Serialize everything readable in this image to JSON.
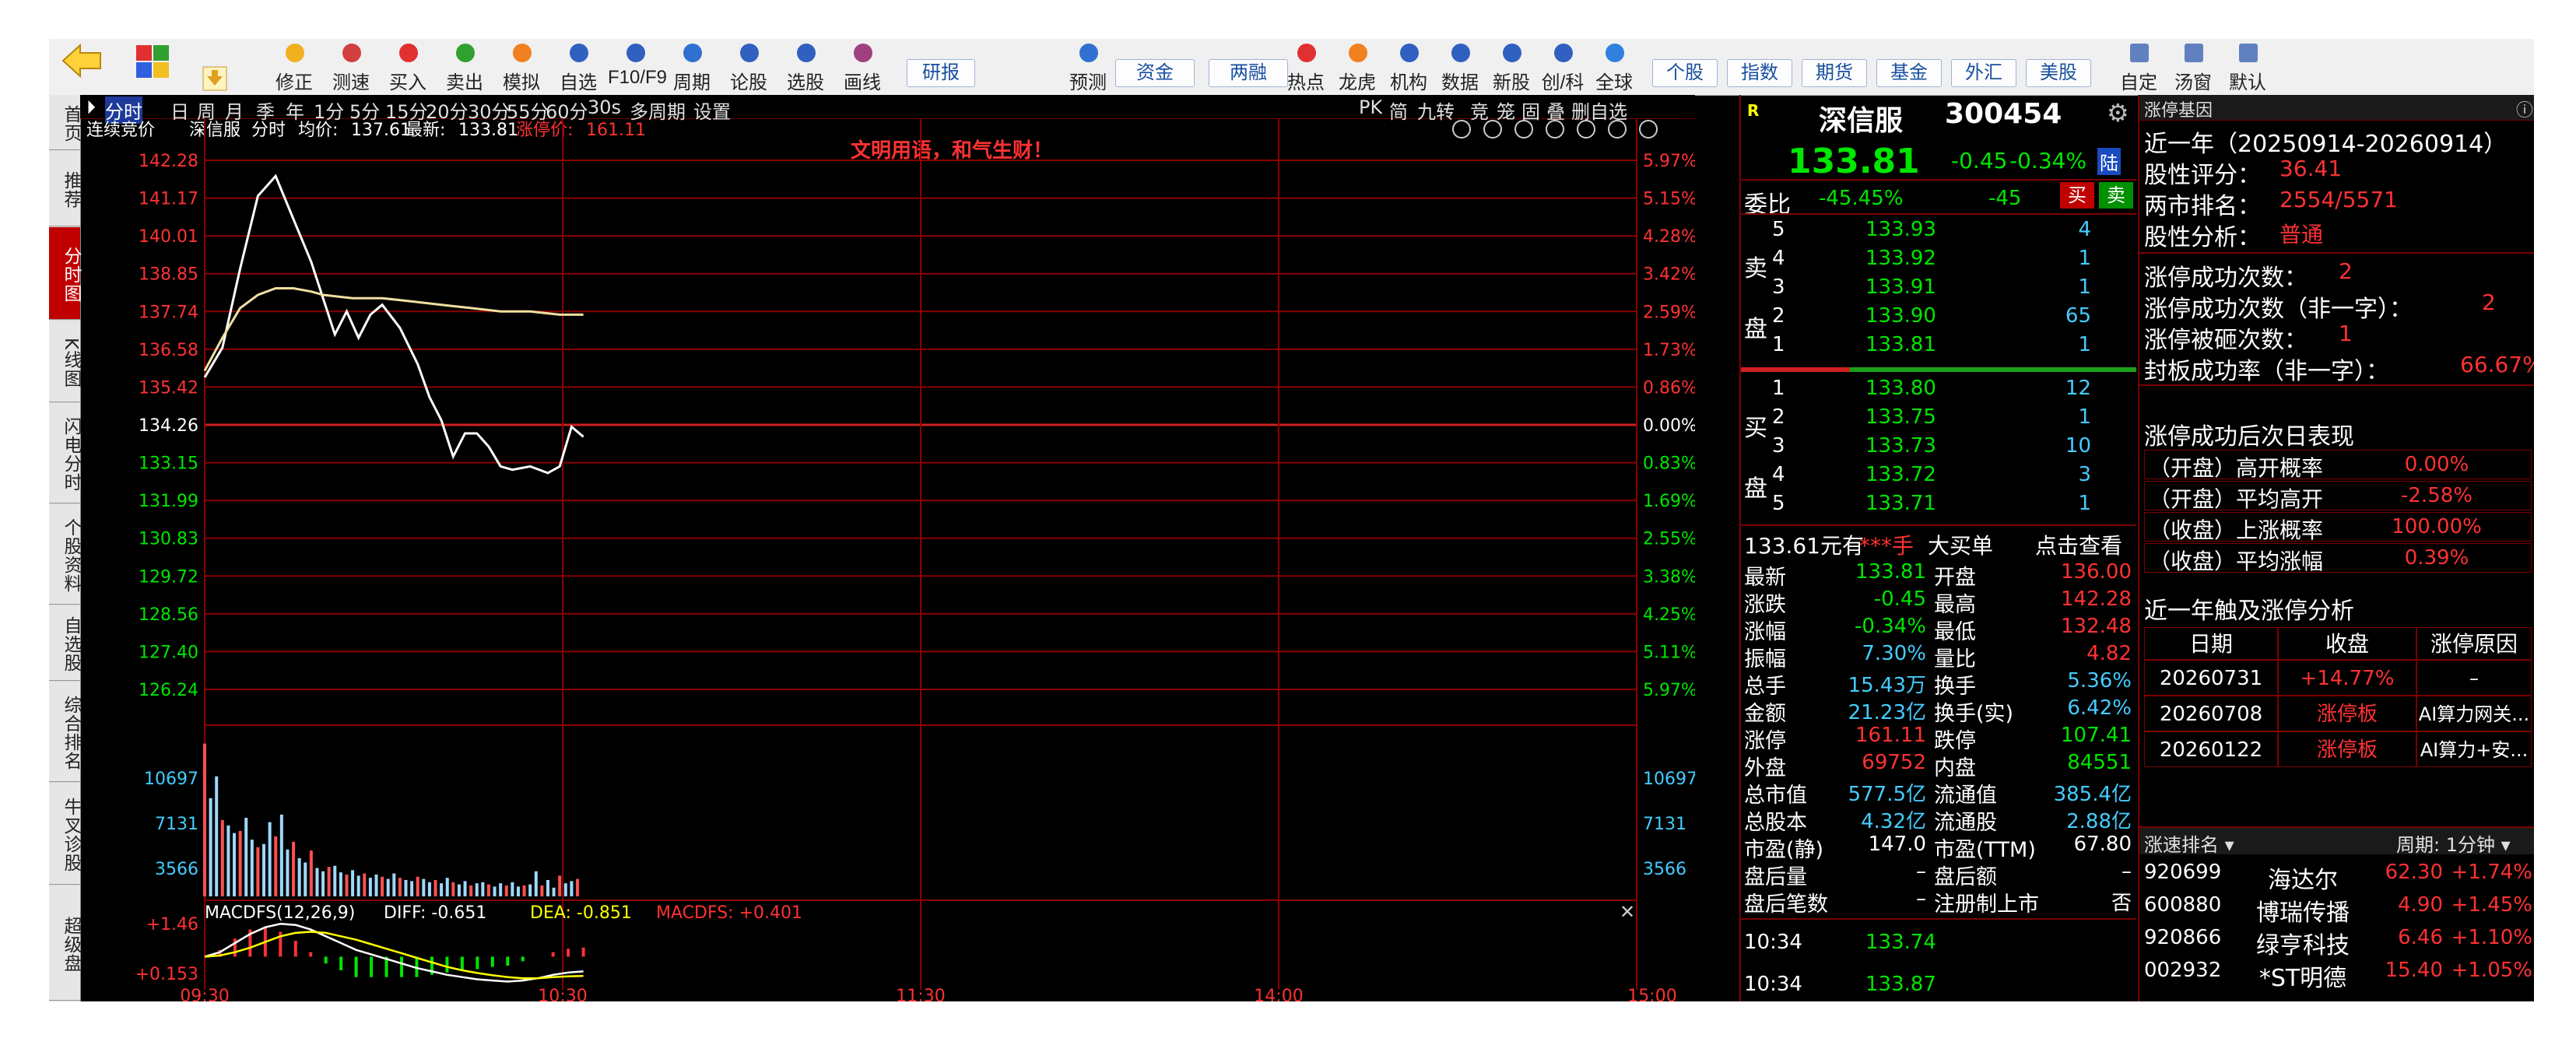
{
  "toolbar": {
    "buttons": [
      "修正",
      "测速",
      "买入",
      "卖出",
      "模拟",
      "自选",
      "F10/F9",
      "周期",
      "论股",
      "选股",
      "画线"
    ],
    "yanbao": "研报",
    "buttons2": [
      "预测"
    ],
    "tabs1": [
      "资金",
      "两融"
    ],
    "buttons3": [
      "热点",
      "龙虎",
      "机构",
      "数据",
      "新股",
      "创/科",
      "全球"
    ],
    "tabs2": [
      "个股",
      "指数",
      "期货",
      "基金",
      "外汇",
      "美股"
    ],
    "buttons4": [
      "自定",
      "汤窗",
      "默认"
    ]
  },
  "left_tabs": [
    "首页",
    "推荐",
    "分时图",
    "K线图",
    "闪电分时",
    "个股资料",
    "自选股",
    "综合排名",
    "牛叉诊股",
    "超级盘"
  ],
  "period_bar": [
    "分时",
    "日",
    "周",
    "月",
    "季",
    "年",
    "1分",
    "5分",
    "15分",
    "20分",
    "30分",
    "55分",
    "60分",
    "30s",
    "多周期",
    "设置"
  ],
  "period_right": [
    "PK",
    "简",
    "九转",
    "竞",
    "笼",
    "固",
    "叠",
    "删自选"
  ],
  "chart_header": {
    "auction": "连续竞价",
    "name": "深信服",
    "mode": "分时",
    "avg_label": "均价:",
    "avg": "137.61",
    "last_label": "最新:",
    "last": "133.81",
    "limit_label": "涨停价:",
    "limit": "161.11",
    "slogan": "文明用语，和气生财！"
  },
  "colors": {
    "up": "#ff3232",
    "down": "#00e600",
    "price_line": "#ffffff",
    "avg_line": "#f0e0a0",
    "grid": "#8b0000",
    "yellow": "#ffff00",
    "cyan": "#44ccff"
  },
  "chart_data": [
    {
      "type": "line",
      "name": "intraday-price",
      "y_ticks_left": [
        "142.28",
        "141.17",
        "140.01",
        "138.85",
        "137.74",
        "136.58",
        "135.42",
        "134.26",
        "133.15",
        "131.99",
        "130.83",
        "129.72",
        "128.56",
        "127.40",
        "126.24"
      ],
      "y_ticks_right": [
        "5.97%",
        "5.15%",
        "4.28%",
        "3.42%",
        "2.59%",
        "1.73%",
        "0.86%",
        "0.00%",
        "0.83%",
        "1.69%",
        "2.55%",
        "3.38%",
        "4.25%",
        "5.11%",
        "5.97%"
      ],
      "ylim": [
        126.24,
        142.28
      ],
      "x_ticks": [
        "09:30",
        "10:30",
        "11:30",
        "14:00",
        "15:00"
      ],
      "series": [
        {
          "name": "price",
          "x": [
            0,
            3,
            6,
            9,
            12,
            15,
            18,
            20,
            22,
            24,
            26,
            28,
            30,
            33,
            36,
            38,
            40,
            42,
            44,
            46,
            48,
            50,
            52,
            55,
            58,
            60,
            62,
            64
          ],
          "values": [
            135.7,
            136.6,
            139.0,
            141.2,
            141.8,
            140.5,
            139.2,
            138.1,
            137.0,
            137.7,
            136.9,
            137.6,
            137.9,
            137.2,
            136.1,
            135.1,
            134.4,
            133.3,
            134.0,
            134.0,
            133.6,
            133.0,
            132.9,
            133.0,
            132.8,
            133.0,
            134.2,
            133.9
          ]
        },
        {
          "name": "avg",
          "x": [
            0,
            3,
            6,
            9,
            12,
            15,
            18,
            20,
            25,
            30,
            35,
            40,
            45,
            50,
            55,
            60,
            64
          ],
          "values": [
            135.9,
            136.9,
            137.8,
            138.2,
            138.4,
            138.4,
            138.3,
            138.2,
            138.1,
            138.1,
            138.0,
            137.9,
            137.8,
            137.7,
            137.7,
            137.6,
            137.6
          ]
        }
      ]
    },
    {
      "type": "bar",
      "name": "volume",
      "y_ticks": [
        "10697",
        "7131",
        "3566"
      ],
      "ylim": [
        0,
        14262
      ],
      "values": [
        14000,
        9000,
        11000,
        7000,
        6500,
        5800,
        6000,
        7200,
        5200,
        4500,
        4800,
        6800,
        5500,
        7500,
        4300,
        5000,
        3500,
        3100,
        4200,
        2600,
        2300,
        2700,
        2800,
        2200,
        2000,
        2400,
        1900,
        2100,
        1700,
        2000,
        1800,
        1600,
        2100,
        1700,
        1500,
        1400,
        1800,
        1600,
        1300,
        1500,
        1200,
        1700,
        1300,
        1100,
        1400,
        1000,
        1200,
        1300,
        1100,
        900,
        1200,
        1000,
        1300,
        900,
        1000,
        1100,
        2300,
        1000,
        1500,
        800,
        1900,
        1200,
        1400,
        1600
      ]
    },
    {
      "type": "bar",
      "name": "MACDFS",
      "title": "MACDFS(12,26,9)",
      "diff_label": "DIFF: -0.651",
      "dea_label": "DEA: -0.851",
      "macd_label": "MACDFS: +0.401",
      "y_ticks": [
        "+1.46",
        "+0.153"
      ],
      "ylim": [
        -1.46,
        1.46
      ],
      "diff": [
        0.0,
        0.2,
        0.6,
        1.0,
        1.3,
        1.45,
        1.4,
        1.2,
        0.9,
        0.6,
        0.3,
        0.1,
        -0.1,
        -0.3,
        -0.5,
        -0.65,
        -0.8,
        -0.9,
        -1.0,
        -1.05,
        -1.1,
        -1.05,
        -0.95,
        -0.8,
        -0.7,
        -0.65
      ],
      "dea": [
        0.0,
        0.05,
        0.2,
        0.4,
        0.65,
        0.9,
        1.05,
        1.1,
        1.05,
        0.9,
        0.75,
        0.55,
        0.35,
        0.15,
        -0.05,
        -0.25,
        -0.45,
        -0.6,
        -0.72,
        -0.82,
        -0.9,
        -0.95,
        -0.95,
        -0.9,
        -0.87,
        -0.85
      ],
      "macd": [
        0.0,
        0.3,
        0.8,
        1.2,
        1.3,
        1.1,
        0.7,
        0.2,
        -0.3,
        -0.6,
        -0.9,
        -0.9,
        -0.9,
        -0.9,
        -0.9,
        -0.8,
        -0.7,
        -0.6,
        -0.55,
        -0.45,
        -0.4,
        -0.2,
        0.0,
        0.2,
        0.35,
        0.4
      ]
    }
  ],
  "quote_panel": {
    "name": "深信服",
    "code": "300454",
    "price": "133.81",
    "change": "-0.45",
    "change_pct": "-0.34%",
    "lu": "陆",
    "wb_label": "委比",
    "wb_pct": "-45.45%",
    "wb_val": "-45",
    "buy_btn": "买",
    "sell_btn": "卖",
    "sell_label": "卖盘",
    "buy_label": "买盘",
    "asks": [
      {
        "lv": "5",
        "price": "133.93",
        "vol": "4"
      },
      {
        "lv": "4",
        "price": "133.92",
        "vol": "1"
      },
      {
        "lv": "3",
        "price": "133.91",
        "vol": "1"
      },
      {
        "lv": "2",
        "price": "133.90",
        "vol": "65"
      },
      {
        "lv": "1",
        "price": "133.81",
        "vol": "1"
      }
    ],
    "bids": [
      {
        "lv": "1",
        "price": "133.80",
        "vol": "12"
      },
      {
        "lv": "2",
        "price": "133.75",
        "vol": "1"
      },
      {
        "lv": "3",
        "price": "133.73",
        "vol": "10"
      },
      {
        "lv": "4",
        "price": "133.72",
        "vol": "3"
      },
      {
        "lv": "5",
        "price": "133.71",
        "vol": "1"
      }
    ],
    "bigorder": {
      "price": "133.61元有",
      "hand": "***手",
      "label": "大买单",
      "link": "点击查看"
    },
    "stats_left": [
      {
        "k": "最新",
        "v": "133.81"
      },
      {
        "k": "涨跌",
        "v": "-0.45"
      },
      {
        "k": "涨幅",
        "v": "-0.34%"
      },
      {
        "k": "振幅",
        "v": "7.30%"
      },
      {
        "k": "总手",
        "v": "15.43万"
      },
      {
        "k": "金额",
        "v": "21.23亿"
      },
      {
        "k": "涨停",
        "v": "161.11"
      },
      {
        "k": "外盘",
        "v": "69752"
      },
      {
        "k": "总市值",
        "v": "577.5亿"
      },
      {
        "k": "总股本",
        "v": "4.32亿"
      },
      {
        "k": "市盈(静)",
        "v": "147.0"
      },
      {
        "k": "盘后量",
        "v": "–"
      },
      {
        "k": "盘后笔数",
        "v": "–"
      }
    ],
    "stats_right": [
      {
        "k": "开盘",
        "v": "136.00"
      },
      {
        "k": "最高",
        "v": "142.28"
      },
      {
        "k": "最低",
        "v": "132.48"
      },
      {
        "k": "量比",
        "v": "4.82"
      },
      {
        "k": "换手",
        "v": "5.36%"
      },
      {
        "k": "换手(实)",
        "v": "6.42%"
      },
      {
        "k": "跌停",
        "v": "107.41"
      },
      {
        "k": "内盘",
        "v": "84551"
      },
      {
        "k": "流通值",
        "v": "385.4亿"
      },
      {
        "k": "流通股",
        "v": "2.88亿"
      },
      {
        "k": "市盈(TTM)",
        "v": "67.80"
      },
      {
        "k": "盘后额",
        "v": "–"
      },
      {
        "k": "注册制上市",
        "v": "否"
      }
    ],
    "ticks": [
      {
        "t": "10:34",
        "p": "133.74"
      },
      {
        "t": "10:34",
        "p": "133.87"
      }
    ]
  },
  "limit_panel": {
    "title": "涨停基因",
    "period": "近一年（20250914-20260914）",
    "rows1": [
      {
        "k": "股性评分：",
        "v": "36.41"
      },
      {
        "k": "两市排名：",
        "v": "2554/5571"
      },
      {
        "k": "股性分析：",
        "v": "普通"
      }
    ],
    "rows2": [
      {
        "k": "涨停成功次数：",
        "v": "2"
      },
      {
        "k": "涨停成功次数（非一字）：",
        "v": "2"
      },
      {
        "k": "涨停被砸次数：",
        "v": "1"
      },
      {
        "k": "封板成功率（非一字）：",
        "v": "66.67%"
      }
    ],
    "after_title": "涨停成功后次日表现",
    "after_rows": [
      {
        "k": "（开盘）高开概率",
        "v": "0.00%"
      },
      {
        "k": "（开盘）平均高开",
        "v": "-2.58%"
      },
      {
        "k": "（收盘）上涨概率",
        "v": "100.00%"
      },
      {
        "k": "（收盘）平均涨幅",
        "v": "0.39%"
      }
    ],
    "analysis_title": "近一年触及涨停分析",
    "table_headers": [
      "日期",
      "收盘",
      "涨停原因"
    ],
    "table_rows": [
      {
        "d": "20260731",
        "c": "+14.77%",
        "r": "–"
      },
      {
        "d": "20260708",
        "c": "涨停板",
        "r": "AI算力网关..."
      },
      {
        "d": "20260122",
        "c": "涨停板",
        "r": "AI算力+安..."
      }
    ]
  },
  "speed_panel": {
    "title": "涨速排名",
    "period": "周期: 1分钟",
    "rows": [
      {
        "code": "920699",
        "name": "海达尔",
        "price": "62.30",
        "pct": "+1.74%"
      },
      {
        "code": "600880",
        "name": "博瑞传播",
        "price": "4.90",
        "pct": "+1.45%"
      },
      {
        "code": "920866",
        "name": "绿亨科技",
        "price": "6.46",
        "pct": "+1.10%"
      },
      {
        "code": "002932",
        "name": "*ST明德",
        "price": "15.40",
        "pct": "+1.05%"
      }
    ]
  }
}
